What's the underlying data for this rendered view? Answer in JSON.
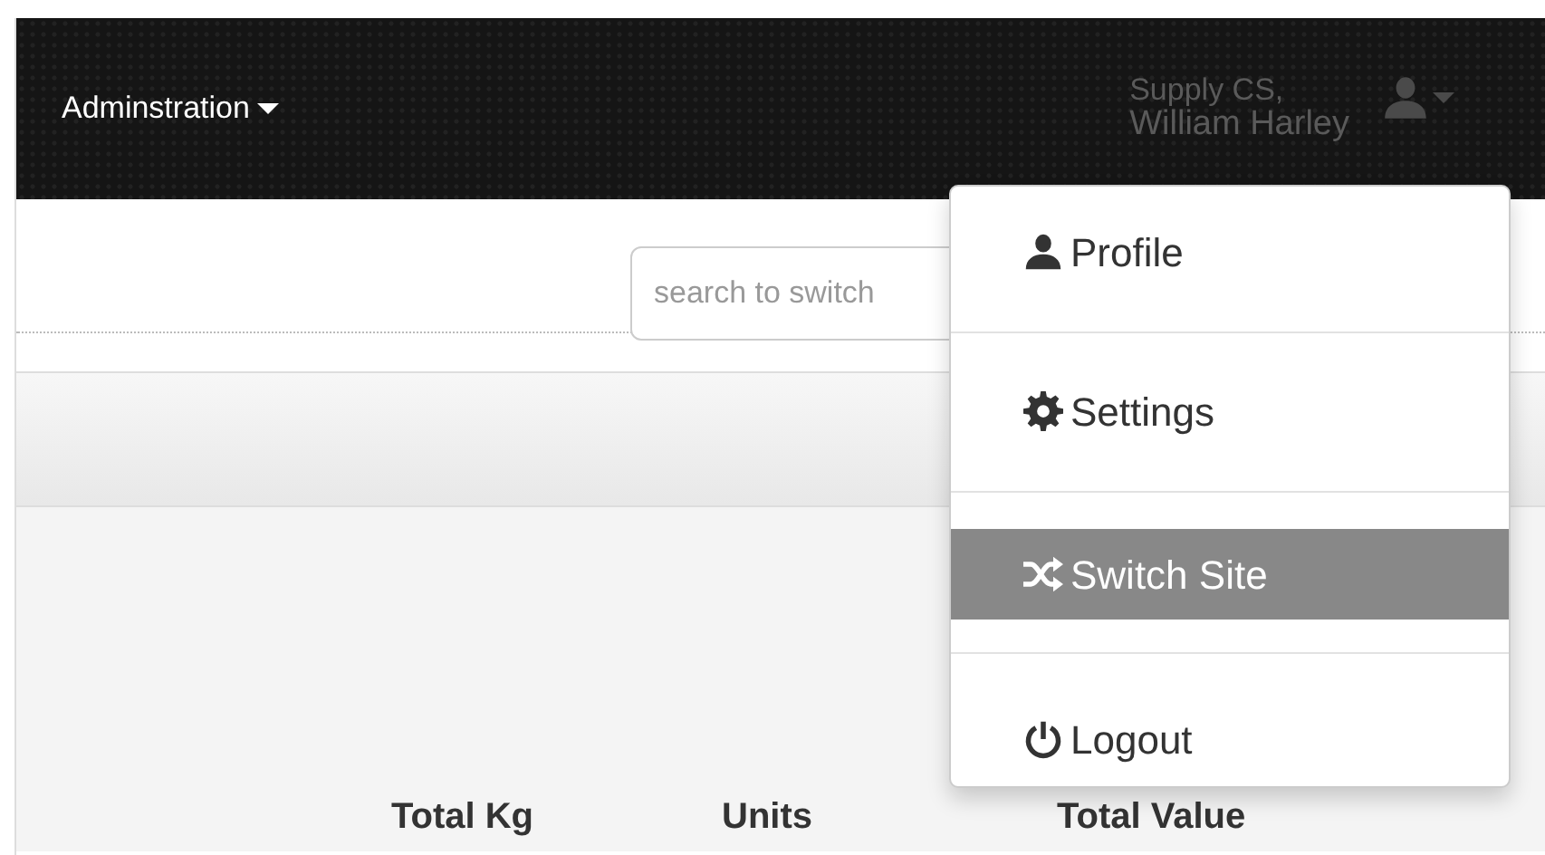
{
  "navbar": {
    "menu": "Adminstration",
    "user_site": "Supply CS,",
    "user_name": "William Harley",
    "user_menu_expanded": true
  },
  "search": {
    "placeholder": "search to switch"
  },
  "table": {
    "columns": [
      "Total Kg",
      "Units",
      "Total Value"
    ]
  },
  "user_menu": [
    {
      "kind": "profile",
      "label": "Profile",
      "selected": false
    },
    {
      "kind": "settings",
      "label": "Settings",
      "selected": false
    },
    {
      "kind": "switch",
      "label": "Switch Site",
      "selected": true
    },
    {
      "kind": "logout",
      "label": "Logout",
      "selected": false
    }
  ]
}
